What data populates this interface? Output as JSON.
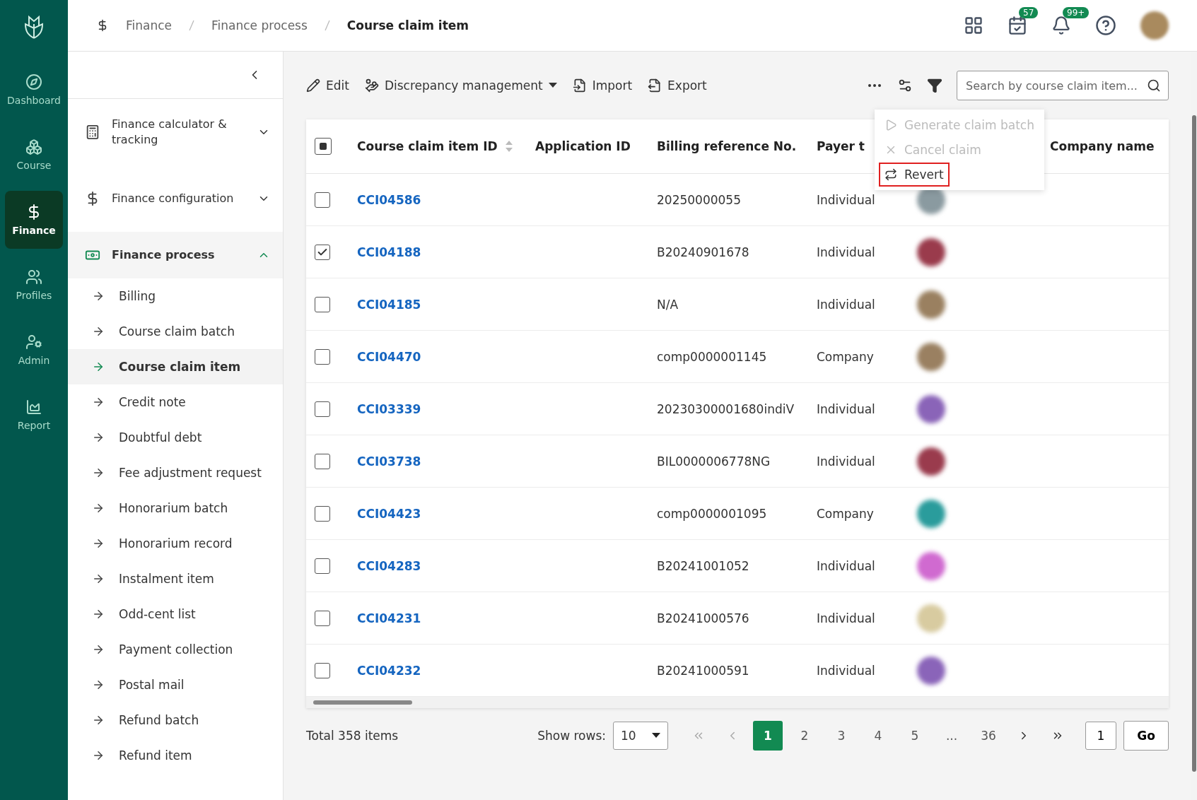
{
  "rail": [
    {
      "label": "Dashboard",
      "selected": false
    },
    {
      "label": "Course",
      "selected": false
    },
    {
      "label": "Finance",
      "selected": true
    },
    {
      "label": "Profiles",
      "selected": false
    },
    {
      "label": "Admin",
      "selected": false
    },
    {
      "label": "Report",
      "selected": false
    }
  ],
  "breadcrumb": [
    "Finance",
    "Finance process",
    "Course claim item"
  ],
  "header_badges": {
    "tasks": "57",
    "notifications": "99+"
  },
  "sidebar": {
    "groups": [
      {
        "label": "Finance calculator & tracking",
        "expanded": false
      },
      {
        "label": "Finance configuration",
        "expanded": false
      },
      {
        "label": "Finance process",
        "expanded": true,
        "children": [
          {
            "label": "Billing",
            "selected": false
          },
          {
            "label": "Course claim batch",
            "selected": false
          },
          {
            "label": "Course claim item",
            "selected": true
          },
          {
            "label": "Credit note",
            "selected": false
          },
          {
            "label": "Doubtful debt",
            "selected": false
          },
          {
            "label": "Fee adjustment request",
            "selected": false
          },
          {
            "label": "Honorarium batch",
            "selected": false
          },
          {
            "label": "Honorarium record",
            "selected": false
          },
          {
            "label": "Instalment item",
            "selected": false
          },
          {
            "label": "Odd-cent list",
            "selected": false
          },
          {
            "label": "Payment collection",
            "selected": false
          },
          {
            "label": "Postal mail",
            "selected": false
          },
          {
            "label": "Refund batch",
            "selected": false
          },
          {
            "label": "Refund item",
            "selected": false
          }
        ]
      }
    ]
  },
  "toolbar": {
    "buttons": [
      {
        "label": "Edit",
        "dropdown": false
      },
      {
        "label": "Discrepancy management",
        "dropdown": true
      },
      {
        "label": "Import",
        "dropdown": false
      },
      {
        "label": "Export",
        "dropdown": false
      }
    ],
    "search": {
      "placeholder": "Search by course claim item..."
    }
  },
  "more_menu": [
    {
      "label": "Generate claim batch",
      "disabled": true,
      "highlighted": false
    },
    {
      "label": "Cancel claim",
      "disabled": true,
      "highlighted": false
    },
    {
      "label": "Revert",
      "disabled": false,
      "highlighted": true
    }
  ],
  "table": {
    "all_selected_partial": true,
    "columns": [
      "Course claim item ID",
      "Application ID",
      "Billing reference No.",
      "Payer t",
      "Company name"
    ],
    "rows": [
      {
        "checked": false,
        "id": "CCI04586",
        "billing": "20250000055",
        "payer": "Individual",
        "color": "#8a9aa0"
      },
      {
        "checked": true,
        "id": "CCI04188",
        "billing": "B20240901678",
        "payer": "Individual",
        "color": "#9a3b4c"
      },
      {
        "checked": false,
        "id": "CCI04185",
        "billing": "N/A",
        "payer": "Individual",
        "color": "#9a8060"
      },
      {
        "checked": false,
        "id": "CCI04470",
        "billing": "comp0000001145",
        "payer": "Company",
        "color": "#9a8061"
      },
      {
        "checked": false,
        "id": "CCI03339",
        "billing": "20230300001680indiV",
        "payer": "Individual",
        "color": "#8a64b8"
      },
      {
        "checked": false,
        "id": "CCI03738",
        "billing": "BIL0000006778NG",
        "payer": "Individual",
        "color": "#9a3b4d"
      },
      {
        "checked": false,
        "id": "CCI04423",
        "billing": "comp0000001095",
        "payer": "Company",
        "color": "#2a9c9c"
      },
      {
        "checked": false,
        "id": "CCI04283",
        "billing": "B20241001052",
        "payer": "Individual",
        "color": "#d06ad0"
      },
      {
        "checked": false,
        "id": "CCI04231",
        "billing": "B20241000576",
        "payer": "Individual",
        "color": "#d8cba0"
      },
      {
        "checked": false,
        "id": "CCI04232",
        "billing": "B20241000591",
        "payer": "Individual",
        "color": "#8a64b9"
      }
    ]
  },
  "footer": {
    "total": "Total 358 items",
    "show_rows_label": "Show rows:",
    "rows_value": "10",
    "pages": [
      {
        "label": "1",
        "selected": true
      },
      {
        "label": "2",
        "selected": false
      },
      {
        "label": "3",
        "selected": false
      },
      {
        "label": "4",
        "selected": false
      },
      {
        "label": "5",
        "selected": false
      },
      {
        "label": "...",
        "selected": false
      },
      {
        "label": "36",
        "selected": false
      }
    ],
    "goto_value": "1",
    "go": "Go"
  }
}
